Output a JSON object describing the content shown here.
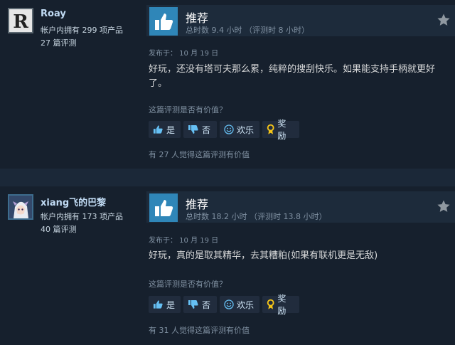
{
  "reviews": [
    {
      "username": "Roay",
      "owned": "帐户内拥有 299 项产品",
      "review_count": "27 篇评测",
      "recommendation": "推荐",
      "hours": "总时数 9.4 小时  （评测时 8 小时）",
      "posted": "发布于：  10 月 19 日",
      "content": "好玩，还没有塔可夫那么累，纯粹的搜刮快乐。如果能支持手柄就更好了。",
      "helpful_question": "这篇评测是否有价值？",
      "buttons": {
        "yes": "是",
        "no": "否",
        "funny": "欢乐",
        "award": "奖励"
      },
      "helpful_count": "有 27 人觉得这篇评测有价值"
    },
    {
      "username": "xiang飞的巴黎",
      "owned": "帐户内拥有 173 项产品",
      "review_count": "40 篇评测",
      "recommendation": "推荐",
      "hours": "总时数 18.2 小时  （评测时 13.8 小时）",
      "posted": "发布于：  10 月 19 日",
      "content": "好玩，真的是取其精华，去其糟粕(如果有联机更是无敌)",
      "helpful_question": "这篇评测是否有价值？",
      "buttons": {
        "yes": "是",
        "no": "否",
        "funny": "欢乐",
        "award": "奖励"
      },
      "helpful_count": "有 31 人觉得这篇评测有价值"
    }
  ],
  "icons": {
    "thumbs_up": "thumbs-up-icon",
    "thumbs_down": "thumbs-down-icon",
    "funny": "smiley-icon",
    "award": "award-icon",
    "star": "star-icon"
  },
  "colors": {
    "page_bg": "#1b2838",
    "review_bg": "#16202d",
    "accent": "#2f86b8",
    "username": "#c1dbf4",
    "award": "#f5c518"
  }
}
